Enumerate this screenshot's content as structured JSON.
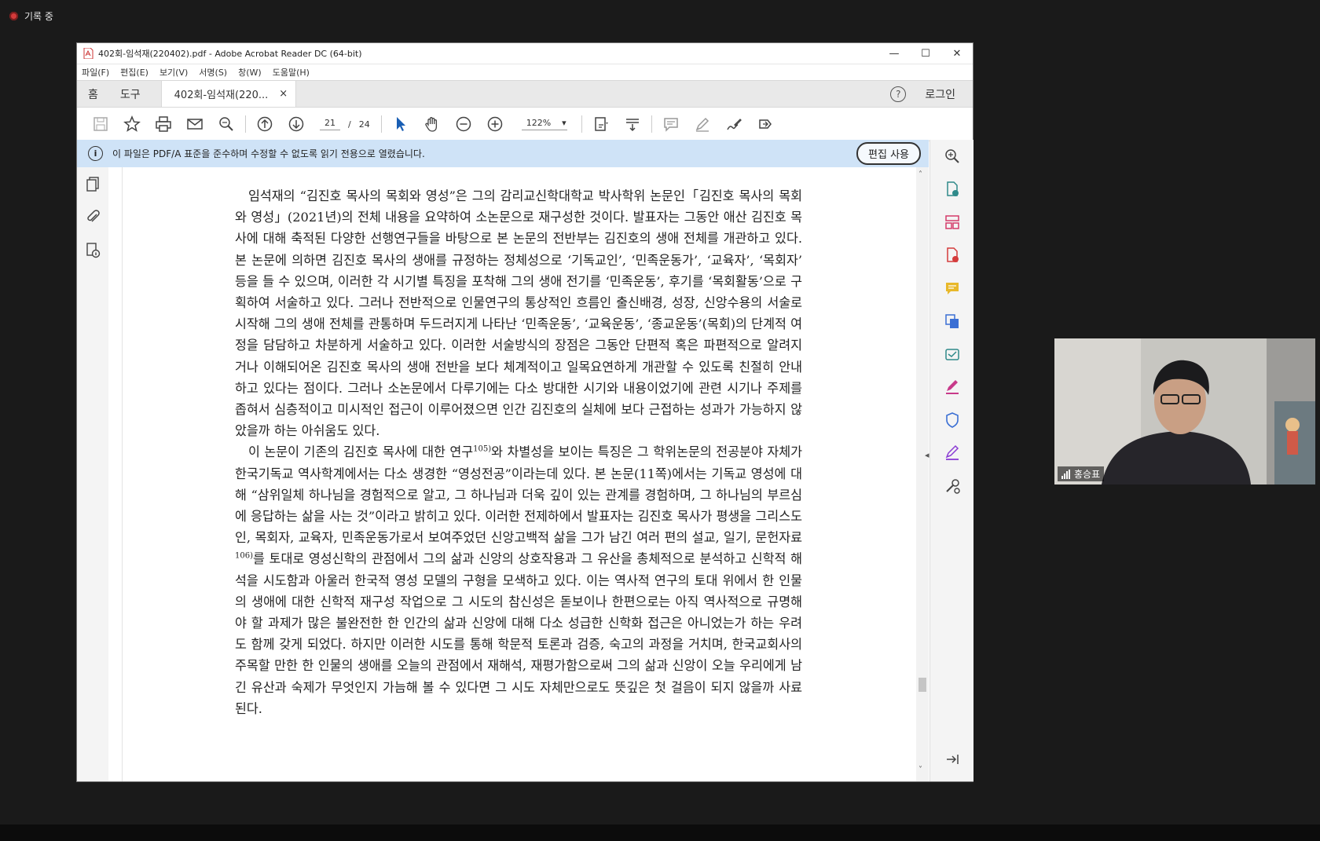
{
  "recording": {
    "label": "기록 중"
  },
  "window": {
    "title": "402회-임석재(220402).pdf - Adobe Acrobat Reader DC (64-bit)",
    "controls": {
      "minimize": "—",
      "maximize": "☐",
      "close": "✕"
    }
  },
  "menu": [
    "파일(F)",
    "편집(E)",
    "보기(V)",
    "서명(S)",
    "창(W)",
    "도움말(H)"
  ],
  "tabs": {
    "home": "홈",
    "tools": "도구",
    "document": "402회-임석재(220...",
    "close": "×",
    "login": "로그인",
    "help": "?"
  },
  "toolbar": {
    "current_page": "21",
    "separator": "/",
    "total_pages": "24",
    "zoom": "122%"
  },
  "notice": {
    "info_glyph": "i",
    "text": "이 파일은 PDF/A 표준을 준수하며 수정할 수 없도록 읽기 전용으로 열렸습니다.",
    "edit_button": "편집 사용"
  },
  "document": {
    "paragraph1": "임석재의 “김진호 목사의 목회와 영성”은 그의 감리교신학대학교 박사학위 논문인「김진호 목사의 목회와 영성」(2021년)의 전체 내용을 요약하여 소논문으로 재구성한 것이다. 발표자는 그동안 애산 김진호 목사에 대해 축적된 다양한 선행연구들을 바탕으로 본 논문의 전반부는 김진호의 생애 전체를 개관하고 있다. 본 논문에 의하면 김진호 목사의 생애를 규정하는 정체성으로 ‘기독교인’, ‘민족운동가’, ‘교육자’, ‘목회자’ 등을 들 수 있으며, 이러한 각 시기별 특징을 포착해 그의 생애 전기를 ‘민족운동’, 후기를 ‘목회활동’으로 구획하여 서술하고 있다. 그러나 전반적으로 인물연구의 통상적인 흐름인 출신배경, 성장, 신앙수용의 서술로 시작해 그의 생애 전체를 관통하며 두드러지게 나타난 ‘민족운동’, ‘교육운동’, ‘종교운동’(목회)의 단계적 여정을 담담하고 차분하게 서술하고 있다. 이러한 서술방식의 장점은 그동안 단편적 혹은 파편적으로 알려지거나 이해되어온 김진호 목사의 생애 전반을 보다 체계적이고 일목요연하게 개관할 수 있도록 친절히 안내하고 있다는 점이다. 그러나 소논문에서 다루기에는 다소 방대한 시기와 내용이었기에 관련 시기나 주제를 좁혀서 심층적이고 미시적인 접근이 이루어졌으면 인간 김진호의 실체에 보다 근접하는 성과가 가능하지 않았을까 하는 아쉬움도 있다.",
    "paragraph2_a": "이 논문이 기존의 김진호 목사에 대한 연구",
    "footnote1": "105)",
    "paragraph2_b": "와 차별성을 보이는 특징은 그 학위논문의 전공분야 자체가 한국기독교 역사학계에서는 다소 생경한 “영성전공”이라는데 있다. 본 논문(11쪽)에서는 기독교 영성에 대해 “삼위일체 하나님을 경험적으로 알고, 그 하나님과 더욱 깊이 있는 관계를 경험하며, 그 하나님의 부르심에 응답하는 삶을 사는 것”이라고 밝히고 있다. 이러한 전제하에서 발표자는 김진호 목사가 평생을 그리스도인, 목회자, 교육자, 민족운동가로서 보여주었던 신앙고백적 삶을 그가 남긴 여러 편의 설교, 일기, 문헌자료",
    "footnote2": "106)",
    "paragraph2_c": "를 토대로 영성신학의 관점에서 그의 삶과 신앙의 상호작용과 그 유산을 총체적으로 분석하고 신학적 해석을 시도함과 아울러 한국적 영성 모델의 구형을 모색하고 있다. 이는 역사적 연구의 토대 위에서 한 인물의 생애에 대한 신학적 재구성 작업으로 그 시도의 참신성은 돋보이나 한편으로는 아직 역사적으로 규명해야 할 과제가 많은 불완전한 한 인간의 삶과 신앙에 대해 다소 성급한 신학화 접근은 아니었는가 하는 우려도 함께 갖게 되었다. 하지만 이러한 시도를 통해 학문적 토론과 검증, 숙고의 과정을 거치며, 한국교회사의 주목할 만한 한 인물의 생애를 오늘의 관점에서 재해석, 재평가함으로써 그의 삶과 신앙이 오늘 우리에게 남긴 유산과 숙제가 무엇인지 가늠해 볼 수 있다면 그 시도 자체만으로도 뜻깊은 첫 걸음이 되지 않을까 사료된다."
  },
  "webcam": {
    "participant": "홍승표"
  },
  "colors": {
    "notice_bg": "#cfe3f7",
    "record_dot": "#d43b3b"
  }
}
